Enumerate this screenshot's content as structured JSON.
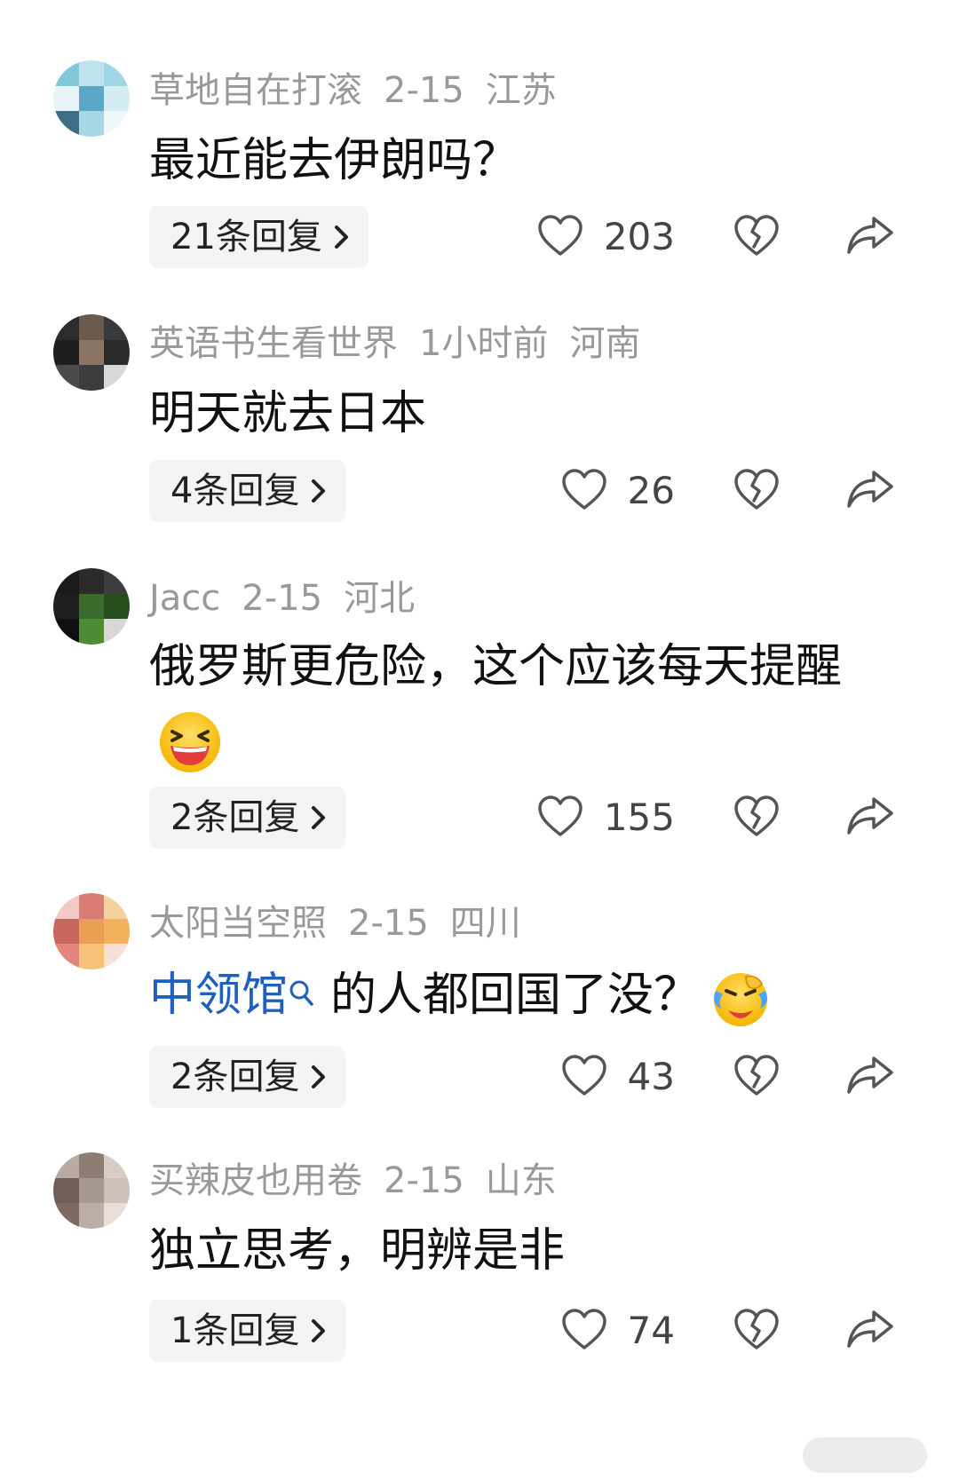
{
  "comments": [
    {
      "username": "草地自在打滚",
      "time": "2-15",
      "location": "江苏",
      "text": "最近能去伊朗吗？",
      "replies_label": "21条回复",
      "likes": "203",
      "avatar_colors": [
        "#7fc7d9",
        "#bfe3ee",
        "#9ed6e6",
        "#e7f4f8",
        "#5ba9c7",
        "#d5ecf3",
        "#3d6e87",
        "#a8d8e4",
        "#eef7fa"
      ]
    },
    {
      "username": "英语书生看世界",
      "time": "1小时前",
      "location": "河南",
      "text": "明天就去日本",
      "replies_label": "4条回复",
      "likes": "26",
      "avatar_colors": [
        "#2c2c2c",
        "#6b5a4e",
        "#3a3a3a",
        "#1e1e1e",
        "#8c7464",
        "#2a2a2a",
        "#4b4b4b",
        "#3c3c3c",
        "#d8d8d8"
      ]
    },
    {
      "username": "Jacc",
      "time": "2-15",
      "location": "河北",
      "text": "俄罗斯更危险，这个应该每天提醒",
      "replies_label": "2条回复",
      "likes": "155",
      "avatar_colors": [
        "#1a1a1a",
        "#2b2b2b",
        "#3d3d3d",
        "#1f1f1f",
        "#3b6b2c",
        "#264d1c",
        "#0f0f0f",
        "#4f8a34",
        "#d7d7d7"
      ]
    },
    {
      "username": "太阳当空照",
      "time": "2-15",
      "location": "四川",
      "text_link": "中领馆",
      "text": "的人都回国了没？",
      "replies_label": "2条回复",
      "likes": "43",
      "avatar_colors": [
        "#f2c9c5",
        "#d97d74",
        "#f4d2a0",
        "#c9665d",
        "#e9a052",
        "#f3b15b",
        "#e2857a",
        "#f6c27a",
        "#f7e0d8"
      ]
    },
    {
      "username": "买辣皮也用卷",
      "time": "2-15",
      "location": "山东",
      "text": "独立思考，明辨是非",
      "replies_label": "1条回复",
      "likes": "74",
      "avatar_colors": [
        "#b9aaa2",
        "#8e7d73",
        "#d9ccc6",
        "#6f5e55",
        "#a89990",
        "#cfc1ba",
        "#7d6b61",
        "#bcaea6",
        "#e7ded9"
      ]
    }
  ]
}
